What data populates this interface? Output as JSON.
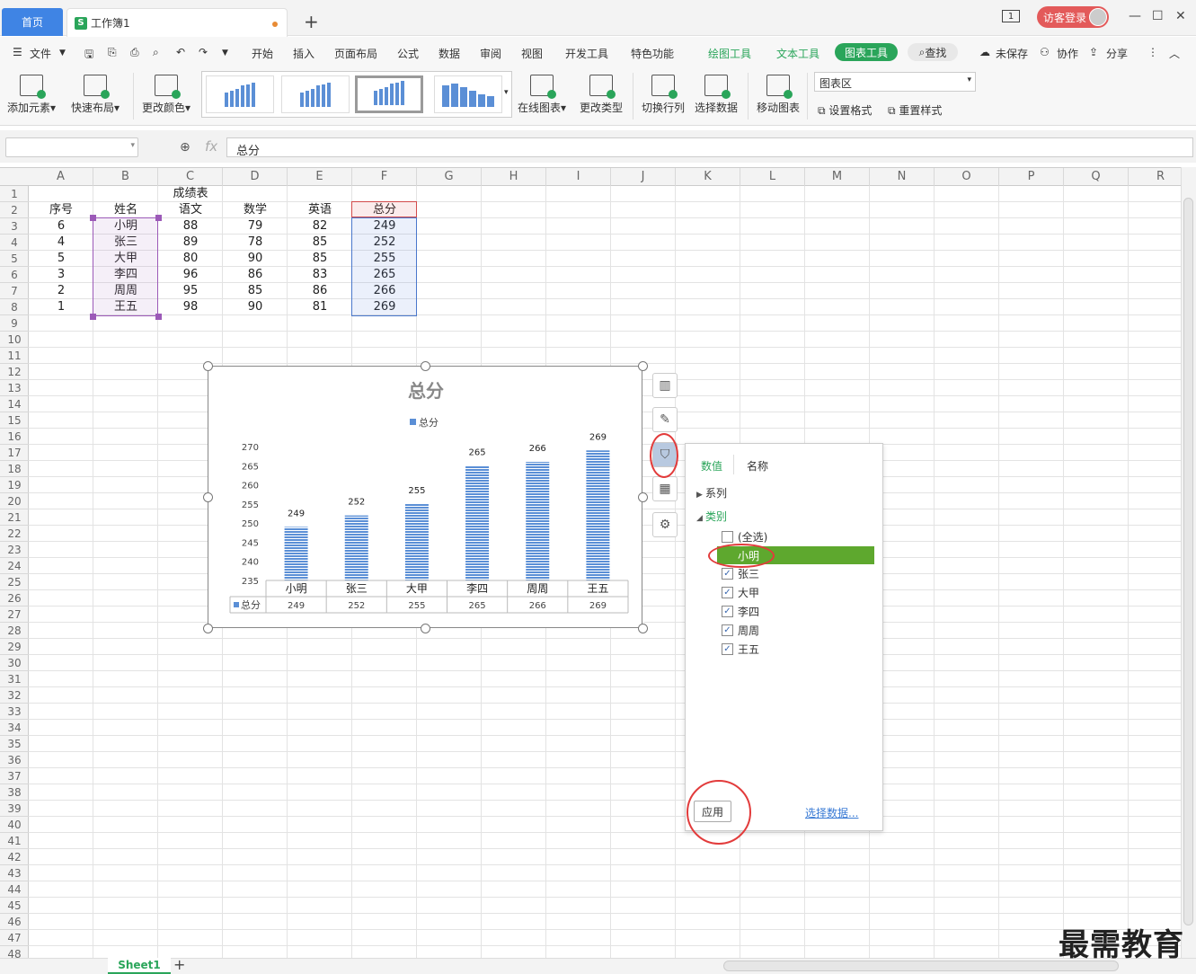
{
  "titlebar": {
    "home_tab": "首页",
    "workbook_tab": "工作簿1",
    "workbook_icon": "S",
    "page_badge": "1",
    "login": "访客登录"
  },
  "menu": {
    "file": "文件",
    "items": [
      "开始",
      "插入",
      "页面布局",
      "公式",
      "数据",
      "审阅",
      "视图",
      "开发工具",
      "特色功能"
    ],
    "green_items": [
      "绘图工具",
      "文本工具"
    ],
    "chart_tool": "图表工具",
    "search": "查找",
    "unsaved": "未保存",
    "collab": "协作",
    "share": "分享"
  },
  "ribbon": {
    "add_element": "添加元素",
    "quick_layout": "快速布局",
    "change_color": "更改颜色",
    "online_chart": "在线图表",
    "change_type": "更改类型",
    "switch_rowcol": "切换行列",
    "select_data": "选择数据",
    "move_chart": "移动图表",
    "chart_area": "图表区",
    "set_format": "设置格式",
    "reset_style": "重置样式"
  },
  "formula_bar": {
    "value": "总分",
    "fx": "fx"
  },
  "columns": [
    "A",
    "B",
    "C",
    "D",
    "E",
    "F",
    "G",
    "H",
    "I",
    "J",
    "K",
    "L",
    "M",
    "N",
    "O",
    "P",
    "Q",
    "R"
  ],
  "sheet": {
    "title": "成绩表",
    "headers": [
      "序号",
      "姓名",
      "语文",
      "数学",
      "英语",
      "总分"
    ],
    "rows": [
      [
        "6",
        "小明",
        "88",
        "79",
        "82",
        "249"
      ],
      [
        "4",
        "张三",
        "89",
        "78",
        "85",
        "252"
      ],
      [
        "5",
        "大甲",
        "80",
        "90",
        "85",
        "255"
      ],
      [
        "3",
        "李四",
        "96",
        "86",
        "83",
        "265"
      ],
      [
        "2",
        "周周",
        "95",
        "85",
        "86",
        "266"
      ],
      [
        "1",
        "王五",
        "98",
        "90",
        "81",
        "269"
      ]
    ]
  },
  "chart_data": {
    "type": "bar",
    "title": "总分",
    "categories": [
      "小明",
      "张三",
      "大甲",
      "李四",
      "周周",
      "王五"
    ],
    "series": [
      {
        "name": "总分",
        "values": [
          249,
          252,
          255,
          265,
          266,
          269
        ],
        "color": "#5b8fd6"
      }
    ],
    "ylim": [
      235,
      270
    ],
    "yticks": [
      235,
      240,
      245,
      250,
      255,
      260,
      265,
      270
    ],
    "legend": "top",
    "data_table": true
  },
  "filter_panel": {
    "tabs": [
      "数值",
      "名称"
    ],
    "series_label": "系列",
    "category_label": "类别",
    "select_all": "(全选)",
    "items": [
      {
        "label": "小明",
        "checked": false
      },
      {
        "label": "张三",
        "checked": true
      },
      {
        "label": "大甲",
        "checked": true
      },
      {
        "label": "李四",
        "checked": true
      },
      {
        "label": "周周",
        "checked": true
      },
      {
        "label": "王五",
        "checked": true
      }
    ],
    "apply": "应用",
    "select_data": "选择数据..."
  },
  "sheet_tab": "Sheet1",
  "watermark": "最需教育"
}
